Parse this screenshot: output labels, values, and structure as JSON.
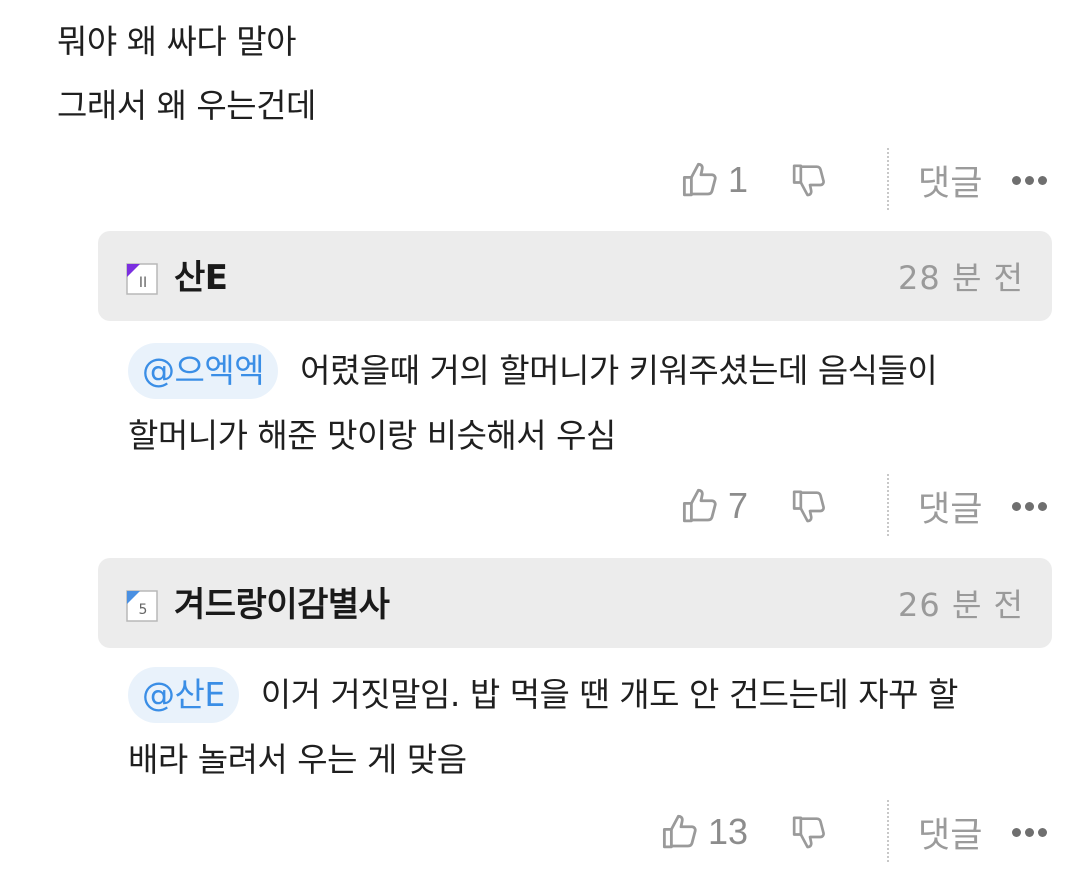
{
  "comment": {
    "lines": [
      "뭐야 왜 싸다 말아",
      "그래서 왜 우는건데"
    ],
    "likes": "1"
  },
  "replies": [
    {
      "username": "산E",
      "time_ago": "28 분 전",
      "mention": "@으엑엑",
      "text_line1": "어렸을때 거의 할머니가 키워주셨는데 음식들이",
      "text_line2": "할머니가 해준 맛이랑 비슷해서 우심",
      "likes": "7",
      "badge_text": "II",
      "badge_color": "#7b2fe0"
    },
    {
      "username": "겨드랑이감별사",
      "time_ago": "26 분 전",
      "mention": "@산E",
      "text_line1": "이거 거짓말임. 밥 먹을 땐 개도 안 건드는데 자꾸 할",
      "text_line2": "배라 놀려서 우는 게 맞음",
      "likes": "13",
      "badge_text": "5",
      "badge_color": "#4a90e2"
    }
  ],
  "actions": {
    "reply_label": "댓글",
    "like_icon": "thumbs-up-icon",
    "dislike_icon": "thumbs-down-icon",
    "more_icon": "more-icon"
  }
}
